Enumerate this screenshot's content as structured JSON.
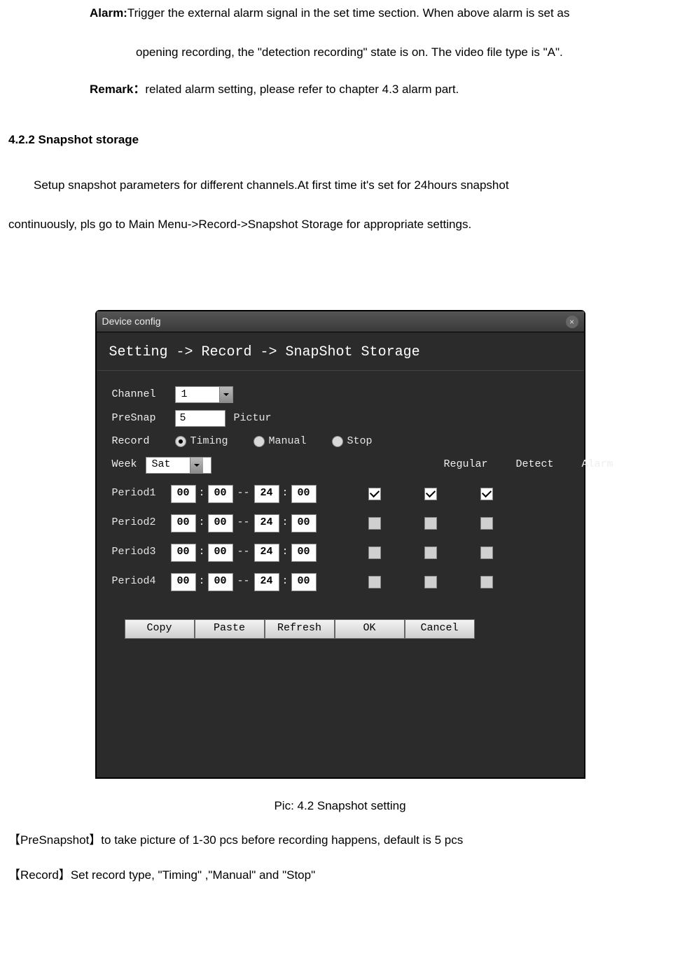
{
  "text": {
    "alarm_label": "Alarm:",
    "alarm_line1": "Trigger the external alarm signal in the set time section. When above alarm is set as",
    "alarm_line2": "opening recording, the \"detection recording\" state is on. The video file type is \"A\".",
    "remark_label": "Remark：",
    "remark_text": "related alarm setting, please refer to chapter 4.3 alarm part.",
    "section_head": "4.2.2 Snapshot storage",
    "setup_line1": "Setup snapshot parameters for different channels.At first time it's set for 24hours snapshot",
    "setup_line2": "continuously, pls go to Main Menu->Record->Snapshot Storage for appropriate settings.",
    "caption": "Pic: 4.2 Snapshot setting",
    "def1_key": "【PreSnapshot】",
    "def1_txt": "to take picture of 1-30 pcs before recording happens, default is 5 pcs",
    "def2_key": "【Record】",
    "def2_txt": "Set record type, \"Timing\" ,\"Manual\" and \"Stop\""
  },
  "dialog": {
    "title": "Device config",
    "breadcrumb": "Setting -> Record -> SnapShot Storage",
    "labels": {
      "channel": "Channel",
      "presnap": "PreSnap",
      "picture": "Pictur",
      "record": "Record",
      "week": "Week",
      "period1": "Period1",
      "period2": "Period2",
      "period3": "Period3",
      "period4": "Period4"
    },
    "values": {
      "channel": "1",
      "presnap": "5",
      "week": "Sat"
    },
    "radios": {
      "timing": "Timing",
      "manual": "Manual",
      "stop": "Stop",
      "selected": "timing"
    },
    "col_headers": {
      "regular": "Regular",
      "detect": "Detect",
      "alarm": "Alarm"
    },
    "periods": [
      {
        "h1": "00",
        "m1": "00",
        "h2": "24",
        "m2": "00",
        "reg": true,
        "det": true,
        "alm": true
      },
      {
        "h1": "00",
        "m1": "00",
        "h2": "24",
        "m2": "00",
        "reg": false,
        "det": false,
        "alm": false
      },
      {
        "h1": "00",
        "m1": "00",
        "h2": "24",
        "m2": "00",
        "reg": false,
        "det": false,
        "alm": false
      },
      {
        "h1": "00",
        "m1": "00",
        "h2": "24",
        "m2": "00",
        "reg": false,
        "det": false,
        "alm": false
      }
    ],
    "buttons": {
      "copy": "Copy",
      "paste": "Paste",
      "refresh": "Refresh",
      "ok": "OK",
      "cancel": "Cancel"
    }
  }
}
